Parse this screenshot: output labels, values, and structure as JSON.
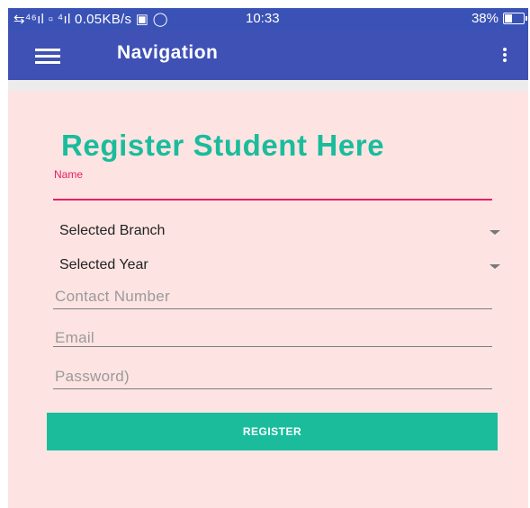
{
  "status_bar": {
    "left_text": "⇆⁴⁶ıl ▫ ⁴ıl 0.05KB/s ▣ ◯",
    "time": "10:33",
    "battery": "38%",
    "battery_level": 0.38
  },
  "app_bar": {
    "title": "Navigation"
  },
  "form": {
    "heading": "Register Student Here",
    "name_label": "Name",
    "branch_selected": "Selected Branch",
    "year_selected": "Selected Year",
    "contact_placeholder": "Contact Number",
    "email_placeholder": "Email",
    "password_placeholder": "Password)",
    "register_label": "REGISTER"
  },
  "colors": {
    "app_bar": "#3f51b5",
    "accent": "#1abc9c",
    "name_field": "#e91e63",
    "background": "#fde4e2"
  },
  "icons": [
    "menu-icon",
    "more-vert-icon",
    "dropdown-arrow-icon",
    "battery-icon"
  ]
}
